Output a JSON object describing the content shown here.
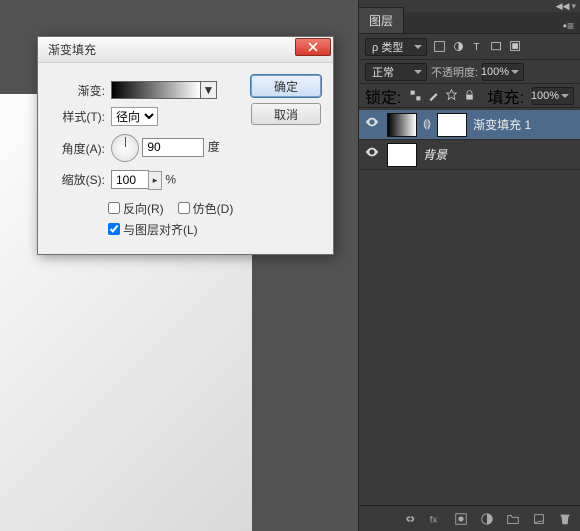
{
  "dialog": {
    "title": "渐变填充",
    "gradient_label": "渐变:",
    "style_label": "样式(T):",
    "style_value": "径向",
    "angle_label": "角度(A):",
    "angle_value": "90",
    "angle_unit": "度",
    "scale_label": "缩放(S):",
    "scale_value": "100",
    "scale_unit": "%",
    "reverse_label": "反向(R)",
    "dither_label": "仿色(D)",
    "align_label": "与图层对齐(L)",
    "ok": "确定",
    "cancel": "取消"
  },
  "panel": {
    "tab": "图层",
    "kind_label": "ρ 类型",
    "blend_mode": "正常",
    "opacity_label": "不透明度:",
    "opacity_value": "100%",
    "lock_label": "锁定:",
    "fill_label": "填充:",
    "fill_value": "100%",
    "layers": [
      {
        "name": "渐变填充 1",
        "selected": true,
        "has_mask": true,
        "thumb": "grad"
      },
      {
        "name": "背景",
        "selected": false,
        "has_mask": false,
        "thumb": "white",
        "italic": true
      }
    ]
  }
}
